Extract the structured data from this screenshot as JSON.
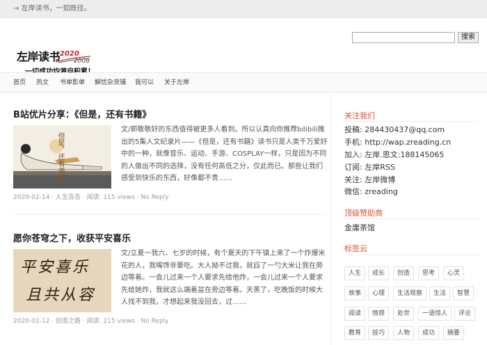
{
  "topbar": {
    "arrow": "→",
    "text": "左岸读书，一如既往。"
  },
  "logo": {
    "main": "左岸读书",
    "year_new": "2020",
    "year_old": "2008",
    "slogan": "一切成功均源自积累！"
  },
  "search": {
    "value": "",
    "button": "搜索"
  },
  "nav": [
    "首页",
    "热文",
    "书单影单",
    "解忧杂货铺",
    "我可以",
    "关于左岸"
  ],
  "posts": [
    {
      "title": "B站优片分享：《但是，还有书籍》",
      "thumb_text": "但是，还有书籍",
      "excerpt": "文/郭敬敬好的东西值得被更多人看到。所以认真向你推荐bilibili推出的5集人文纪录片——《但是，还有书籍》读书只是人类千万爱好中的一种，就像音乐、运动、手游、COSPLAY一样，只是因为不同的人做出不同的选择，没有任何高低之分，仅此而已。那些让我们感受到快乐的东西，好像都不贵……",
      "date": "2020-02-14",
      "category": "人生百态",
      "views": "阅读: 115 views",
      "reply": "No Reply"
    },
    {
      "title": "愿你苍穹之下，收获平安喜乐",
      "thumb_line1": "平安喜乐",
      "thumb_line2": "且共从容",
      "excerpt": "文/立夏一我六、七岁的时候，有个夏天的下午镇上来了一个炸爆米花的人，我嘴馋非要吃。大人拗不过我，就舀了一勺大米让我在旁边等着。一会儿过来一个人要求先给他炸，一会儿过来一个人要求先给她炸，我就这么端着盆在旁边等着。天黑了，吃晚饭的时候大人找不到我，才想起来我没回去，过……",
      "date": "2020-02-12",
      "category": "创造之路",
      "views": "阅读: 215 views",
      "reply": "No Reply"
    }
  ],
  "meta_sep": " · ",
  "sidebar": {
    "follow_title": "关注我们",
    "follow": [
      {
        "label": "投稿:",
        "value": "284430437@qq.com"
      },
      {
        "label": "手机:",
        "value": "http://wap.zreading.cn"
      },
      {
        "label": "加入:",
        "value": "左岸.思文:188145065"
      },
      {
        "label": "订阅:",
        "value": "左岸RSS"
      },
      {
        "label": "关注:",
        "value": "左岸微博"
      },
      {
        "label": "微信:",
        "value": "zreading"
      }
    ],
    "sponsor_title": "顶级赞助商",
    "sponsor": "金庸茶馆",
    "tags_title": "标签云",
    "tags": [
      "人生",
      "成长",
      "创造",
      "思考",
      "心灵",
      "故事",
      "心理",
      "生活观察",
      "生活",
      "智慧",
      "阅读",
      "情感",
      "处世",
      "一语惊人",
      "评论",
      "教育",
      "技巧",
      "人物",
      "成功",
      "摘要"
    ]
  },
  "colors": {
    "accent": "#d9502b",
    "logo_red": "#d21d1d"
  }
}
